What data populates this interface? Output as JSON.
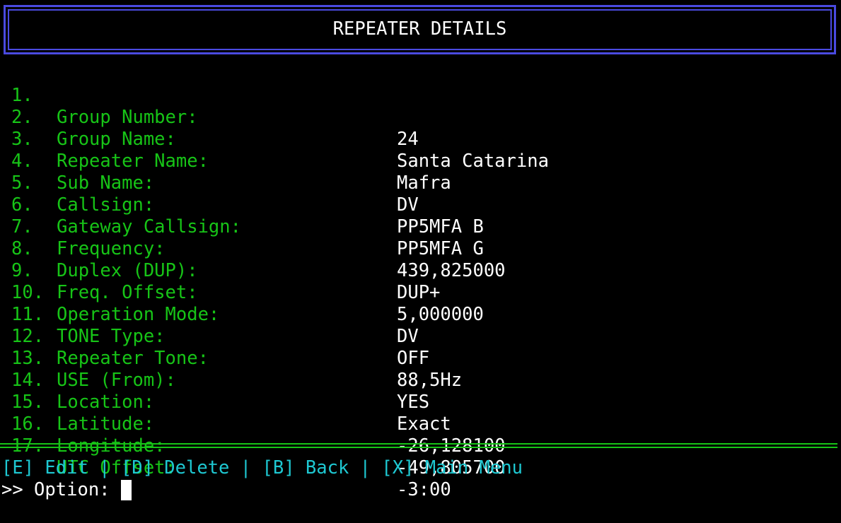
{
  "header": {
    "title": "REPEATER DETAILS"
  },
  "fields": [
    {
      "num": "1.",
      "label": "Group Number:",
      "value": "24"
    },
    {
      "num": "2.",
      "label": "Group Name:",
      "value": "Santa Catarina"
    },
    {
      "num": "3.",
      "label": "Repeater Name:",
      "value": "Mafra"
    },
    {
      "num": "4.",
      "label": "Sub Name:",
      "value": "DV"
    },
    {
      "num": "5.",
      "label": "Callsign:",
      "value": "PP5MFA B"
    },
    {
      "num": "6.",
      "label": "Gateway Callsign:",
      "value": "PP5MFA G"
    },
    {
      "num": "7.",
      "label": "Frequency:",
      "value": "439,825000"
    },
    {
      "num": "8.",
      "label": "Duplex (DUP):",
      "value": "DUP+"
    },
    {
      "num": "9.",
      "label": "Freq. Offset:",
      "value": "5,000000"
    },
    {
      "num": "10.",
      "label": "Operation Mode:",
      "value": "DV"
    },
    {
      "num": "11.",
      "label": "TONE Type:",
      "value": "OFF"
    },
    {
      "num": "12.",
      "label": "Repeater Tone:",
      "value": "88,5Hz"
    },
    {
      "num": "13.",
      "label": "USE (From):",
      "value": "YES"
    },
    {
      "num": "14.",
      "label": "Location:",
      "value": "Exact"
    },
    {
      "num": "15.",
      "label": "Latitude:",
      "value": "-26,128100"
    },
    {
      "num": "16.",
      "label": "Longitude:",
      "value": "-49,805700"
    },
    {
      "num": "17.",
      "label": "UTC Offset:",
      "value": "-3:00"
    }
  ],
  "menu": {
    "edit": "[E] Edit",
    "sep1": " | ",
    "delete": "[D] Delete",
    "sep2": " | ",
    "back": "[B] Back",
    "sep3": " | ",
    "main_menu": "[X] Main Menu"
  },
  "prompt": {
    "text": ">> Option: "
  },
  "colors": {
    "background": "#000000",
    "header_border": "#4a4ae0",
    "label": "#17c417",
    "value": "#ffffff",
    "menu": "#1ec8d2",
    "separator": "#17c417"
  }
}
